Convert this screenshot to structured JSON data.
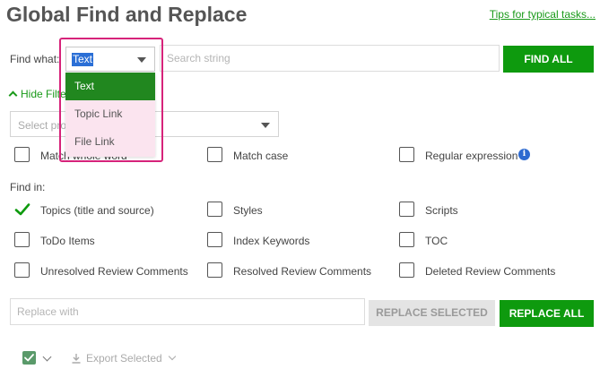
{
  "header": {
    "title": "Global Find and Replace",
    "tips_link": "Tips for typical tasks..."
  },
  "find": {
    "label": "Find what:",
    "type_selected": "Text",
    "search_placeholder": "Search string",
    "search_value": "",
    "find_all_label": "FIND ALL"
  },
  "type_dropdown": {
    "options": [
      "Text",
      "Topic Link",
      "File Link"
    ],
    "selected_index": 0
  },
  "filters": {
    "toggle_label": "Hide Filters",
    "project_placeholder": "Select project",
    "options": [
      {
        "label": "Match whole word",
        "checked": false
      },
      {
        "label": "Match case",
        "checked": false
      },
      {
        "label": "Regular expression",
        "checked": false
      }
    ]
  },
  "find_in": {
    "label": "Find in:",
    "items": [
      {
        "label": "Topics (title and source)",
        "checked": true
      },
      {
        "label": "Styles",
        "checked": false
      },
      {
        "label": "Scripts",
        "checked": false
      },
      {
        "label": "ToDo Items",
        "checked": false
      },
      {
        "label": "Index Keywords",
        "checked": false
      },
      {
        "label": "TOC",
        "checked": false
      },
      {
        "label": "Unresolved Review Comments",
        "checked": false
      },
      {
        "label": "Resolved Review Comments",
        "checked": false
      },
      {
        "label": "Deleted Review Comments",
        "checked": false
      }
    ]
  },
  "replace": {
    "placeholder": "Replace with",
    "value": "",
    "replace_selected_label": "REPLACE SELECTED",
    "replace_all_label": "REPLACE ALL"
  },
  "results_toolbar": {
    "export_label": "Export Selected"
  },
  "colors": {
    "accent_green": "#0e9a0e",
    "link_green": "#1a9a1a",
    "highlight_pink": "#d6237a",
    "dropdown_bg": "#fbe4ef",
    "info_blue": "#2d6ad0"
  },
  "icons": {
    "checkbox_checked": "check-icon",
    "info": "info-icon",
    "download": "download-icon",
    "chevron": "chevron-down-icon"
  }
}
